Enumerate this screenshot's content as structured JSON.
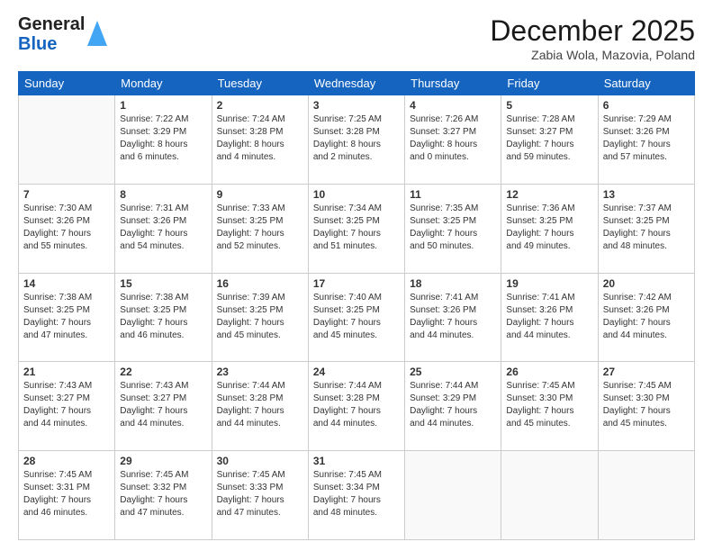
{
  "header": {
    "logo_general": "General",
    "logo_blue": "Blue",
    "month_title": "December 2025",
    "location": "Zabia Wola, Mazovia, Poland"
  },
  "calendar": {
    "days_of_week": [
      "Sunday",
      "Monday",
      "Tuesday",
      "Wednesday",
      "Thursday",
      "Friday",
      "Saturday"
    ],
    "weeks": [
      [
        {
          "day": "",
          "info": ""
        },
        {
          "day": "1",
          "info": "Sunrise: 7:22 AM\nSunset: 3:29 PM\nDaylight: 8 hours\nand 6 minutes."
        },
        {
          "day": "2",
          "info": "Sunrise: 7:24 AM\nSunset: 3:28 PM\nDaylight: 8 hours\nand 4 minutes."
        },
        {
          "day": "3",
          "info": "Sunrise: 7:25 AM\nSunset: 3:28 PM\nDaylight: 8 hours\nand 2 minutes."
        },
        {
          "day": "4",
          "info": "Sunrise: 7:26 AM\nSunset: 3:27 PM\nDaylight: 8 hours\nand 0 minutes."
        },
        {
          "day": "5",
          "info": "Sunrise: 7:28 AM\nSunset: 3:27 PM\nDaylight: 7 hours\nand 59 minutes."
        },
        {
          "day": "6",
          "info": "Sunrise: 7:29 AM\nSunset: 3:26 PM\nDaylight: 7 hours\nand 57 minutes."
        }
      ],
      [
        {
          "day": "7",
          "info": "Sunrise: 7:30 AM\nSunset: 3:26 PM\nDaylight: 7 hours\nand 55 minutes."
        },
        {
          "day": "8",
          "info": "Sunrise: 7:31 AM\nSunset: 3:26 PM\nDaylight: 7 hours\nand 54 minutes."
        },
        {
          "day": "9",
          "info": "Sunrise: 7:33 AM\nSunset: 3:25 PM\nDaylight: 7 hours\nand 52 minutes."
        },
        {
          "day": "10",
          "info": "Sunrise: 7:34 AM\nSunset: 3:25 PM\nDaylight: 7 hours\nand 51 minutes."
        },
        {
          "day": "11",
          "info": "Sunrise: 7:35 AM\nSunset: 3:25 PM\nDaylight: 7 hours\nand 50 minutes."
        },
        {
          "day": "12",
          "info": "Sunrise: 7:36 AM\nSunset: 3:25 PM\nDaylight: 7 hours\nand 49 minutes."
        },
        {
          "day": "13",
          "info": "Sunrise: 7:37 AM\nSunset: 3:25 PM\nDaylight: 7 hours\nand 48 minutes."
        }
      ],
      [
        {
          "day": "14",
          "info": "Sunrise: 7:38 AM\nSunset: 3:25 PM\nDaylight: 7 hours\nand 47 minutes."
        },
        {
          "day": "15",
          "info": "Sunrise: 7:38 AM\nSunset: 3:25 PM\nDaylight: 7 hours\nand 46 minutes."
        },
        {
          "day": "16",
          "info": "Sunrise: 7:39 AM\nSunset: 3:25 PM\nDaylight: 7 hours\nand 45 minutes."
        },
        {
          "day": "17",
          "info": "Sunrise: 7:40 AM\nSunset: 3:25 PM\nDaylight: 7 hours\nand 45 minutes."
        },
        {
          "day": "18",
          "info": "Sunrise: 7:41 AM\nSunset: 3:26 PM\nDaylight: 7 hours\nand 44 minutes."
        },
        {
          "day": "19",
          "info": "Sunrise: 7:41 AM\nSunset: 3:26 PM\nDaylight: 7 hours\nand 44 minutes."
        },
        {
          "day": "20",
          "info": "Sunrise: 7:42 AM\nSunset: 3:26 PM\nDaylight: 7 hours\nand 44 minutes."
        }
      ],
      [
        {
          "day": "21",
          "info": "Sunrise: 7:43 AM\nSunset: 3:27 PM\nDaylight: 7 hours\nand 44 minutes."
        },
        {
          "day": "22",
          "info": "Sunrise: 7:43 AM\nSunset: 3:27 PM\nDaylight: 7 hours\nand 44 minutes."
        },
        {
          "day": "23",
          "info": "Sunrise: 7:44 AM\nSunset: 3:28 PM\nDaylight: 7 hours\nand 44 minutes."
        },
        {
          "day": "24",
          "info": "Sunrise: 7:44 AM\nSunset: 3:28 PM\nDaylight: 7 hours\nand 44 minutes."
        },
        {
          "day": "25",
          "info": "Sunrise: 7:44 AM\nSunset: 3:29 PM\nDaylight: 7 hours\nand 44 minutes."
        },
        {
          "day": "26",
          "info": "Sunrise: 7:45 AM\nSunset: 3:30 PM\nDaylight: 7 hours\nand 45 minutes."
        },
        {
          "day": "27",
          "info": "Sunrise: 7:45 AM\nSunset: 3:30 PM\nDaylight: 7 hours\nand 45 minutes."
        }
      ],
      [
        {
          "day": "28",
          "info": "Sunrise: 7:45 AM\nSunset: 3:31 PM\nDaylight: 7 hours\nand 46 minutes."
        },
        {
          "day": "29",
          "info": "Sunrise: 7:45 AM\nSunset: 3:32 PM\nDaylight: 7 hours\nand 47 minutes."
        },
        {
          "day": "30",
          "info": "Sunrise: 7:45 AM\nSunset: 3:33 PM\nDaylight: 7 hours\nand 47 minutes."
        },
        {
          "day": "31",
          "info": "Sunrise: 7:45 AM\nSunset: 3:34 PM\nDaylight: 7 hours\nand 48 minutes."
        },
        {
          "day": "",
          "info": ""
        },
        {
          "day": "",
          "info": ""
        },
        {
          "day": "",
          "info": ""
        }
      ]
    ]
  }
}
